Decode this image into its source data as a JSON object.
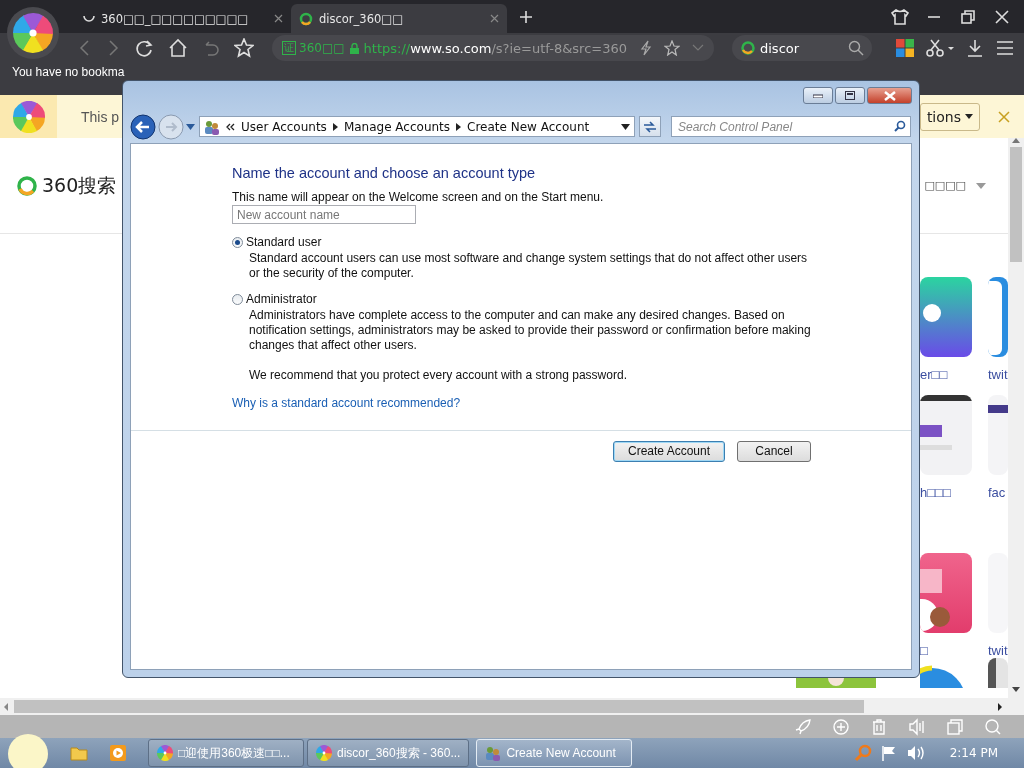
{
  "browser": {
    "tabs": [
      {
        "title": "360□□_□□□□□□□□□",
        "selected": false,
        "loading": true
      },
      {
        "title": "discor_360□□",
        "selected": true,
        "loading": false
      }
    ],
    "address": {
      "badge_mark": "证",
      "badge": "360□□",
      "scheme": "https://",
      "host": "www.so.com",
      "path": "/s?ie=utf-8&src=360"
    },
    "search": {
      "value": "discor"
    },
    "bookmark_notice": "You have no bookma"
  },
  "notification": {
    "text": "This p",
    "button": "tions"
  },
  "page": {
    "logo": "360搜索",
    "menu": "□□□□",
    "tiles": [
      {
        "label": "er□□",
        "kind": "picture"
      },
      {
        "label": "twit",
        "kind": "picture"
      },
      {
        "label": "h□□□",
        "kind": "picture"
      },
      {
        "label": "fac",
        "kind": "picture"
      },
      {
        "label": "□",
        "kind": "picture"
      },
      {
        "label": "twit",
        "kind": "picture"
      }
    ]
  },
  "dialog": {
    "breadcrumb": [
      "User Accounts",
      "Manage Accounts",
      "Create New Account"
    ],
    "search_placeholder": "Search Control Panel",
    "heading": "Name the account and choose an account type",
    "intro": "This name will appear on the Welcome screen and on the Start menu.",
    "name_field": {
      "placeholder": "New account name"
    },
    "account_types": [
      {
        "label": "Standard user",
        "description": "Standard account users can use most software and change system settings that do not affect other users or the security of the computer.",
        "selected": true
      },
      {
        "label": "Administrator",
        "description": "Administrators have complete access to the computer and can make any desired changes. Based on notification settings, administrators may be asked to provide their password or confirmation before making changes that affect other users.",
        "selected": false
      }
    ],
    "note": "We recommend that you protect every account with a strong password.",
    "link": "Why is a standard account recommended?",
    "buttons": [
      {
        "label": "Create Account",
        "default": true
      },
      {
        "label": "Cancel",
        "default": false
      }
    ]
  },
  "taskbar": {
    "tasks": [
      {
        "title": "□迎使用360极速□□...",
        "selected": false
      },
      {
        "title": "discor_360搜索 - 360...",
        "selected": false
      },
      {
        "title": "Create New Account",
        "selected": true
      }
    ],
    "clock": "2:14 PM"
  }
}
